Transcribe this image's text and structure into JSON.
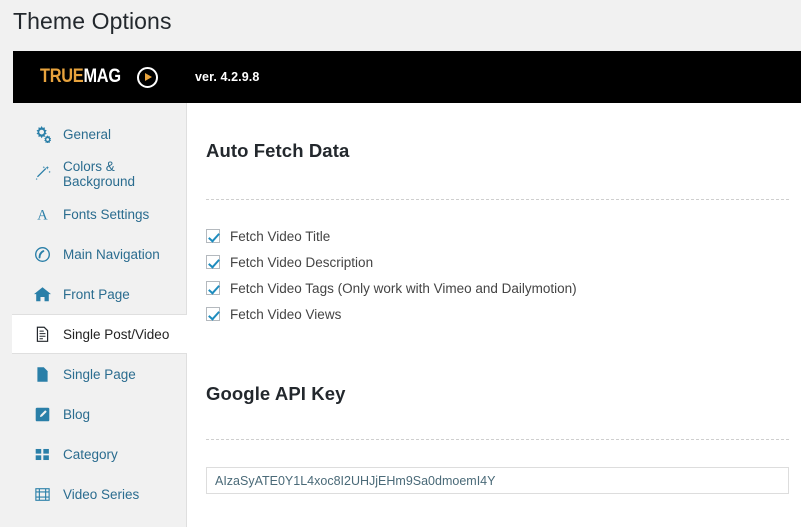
{
  "page": {
    "title": "Theme Options"
  },
  "brand": {
    "logo_primary": "TRUE",
    "logo_secondary": "MAG",
    "play_icon": "play-circle-icon",
    "version": "ver. 4.2.9.8"
  },
  "sidebar": {
    "items": [
      {
        "label": "General",
        "icon": "gears-icon",
        "active": false
      },
      {
        "label": "Colors & Background",
        "icon": "magic-wand-icon",
        "active": false
      },
      {
        "label": "Fonts Settings",
        "icon": "letter-a-icon",
        "active": false
      },
      {
        "label": "Main Navigation",
        "icon": "target-menu-icon",
        "active": false
      },
      {
        "label": "Front Page",
        "icon": "home-icon",
        "active": false
      },
      {
        "label": "Single Post/Video",
        "icon": "document-edit-icon",
        "active": true
      },
      {
        "label": "Single Page",
        "icon": "page-icon",
        "active": false
      },
      {
        "label": "Blog",
        "icon": "pencil-square-icon",
        "active": false
      },
      {
        "label": "Category",
        "icon": "grid-squares-icon",
        "active": false
      },
      {
        "label": "Video Series",
        "icon": "filmstrip-icon",
        "active": false
      }
    ]
  },
  "content": {
    "auto_fetch": {
      "heading": "Auto Fetch Data",
      "options": [
        {
          "label": "Fetch Video Title",
          "checked": true
        },
        {
          "label": "Fetch Video Description",
          "checked": true
        },
        {
          "label": "Fetch Video Tags (Only work with Vimeo and Dailymotion)",
          "checked": true
        },
        {
          "label": "Fetch Video Views",
          "checked": true
        }
      ]
    },
    "google_api": {
      "heading": "Google API Key",
      "value": "AIzaSyATE0Y1L4xoc8I2UHJjEHm9Sa0dmoemI4Y",
      "placeholder": ""
    }
  },
  "colors": {
    "brand_gold": "#e8a33d",
    "link_blue": "#2a6c8f",
    "icon_blue": "#2a7fa8",
    "check_blue": "#1e8cbe",
    "header_black": "#000000",
    "page_bg": "#f1f1f1"
  }
}
